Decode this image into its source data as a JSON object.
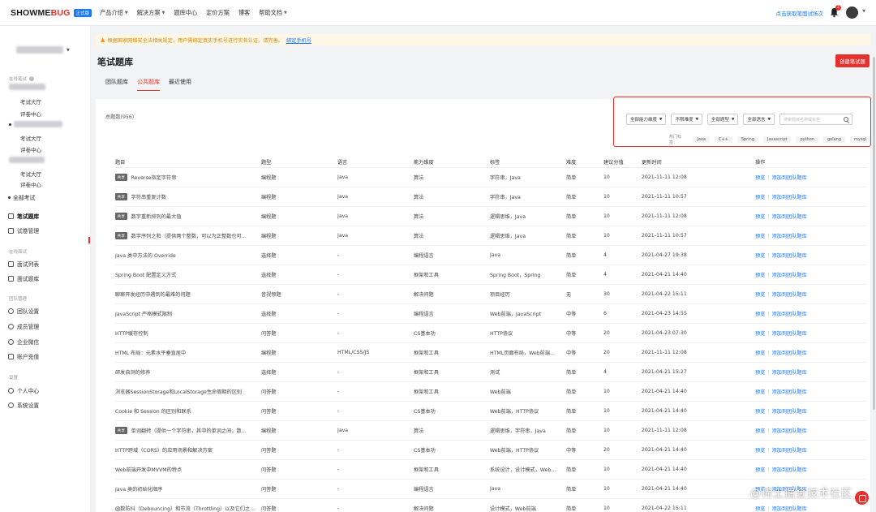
{
  "header": {
    "logo_main": "SHOWME",
    "logo_accent": "BUG",
    "version_badge": "正式版",
    "nav": [
      {
        "label": "产品介绍",
        "has_caret": true
      },
      {
        "label": "解决方案",
        "has_caret": true
      },
      {
        "label": "题库中心",
        "has_caret": false
      },
      {
        "label": "定价方案",
        "has_caret": false
      },
      {
        "label": "博客",
        "has_caret": false
      },
      {
        "label": "帮助文档",
        "has_caret": true
      }
    ],
    "trial_link": "点击获取笔面试场次",
    "bell_count": "2"
  },
  "sidebar": {
    "section_written": "在线笔试",
    "exam_hall_1": "考试大厅",
    "review_1": "评卷中心",
    "exam_hall_2": "考试大厅",
    "review_2": "评卷中心",
    "exam_hall_3": "考试大厅",
    "review_3": "评卷中心",
    "all_exams": "全部考试",
    "question_bank": "笔试题库",
    "paper_manage": "试卷管理",
    "section_interview": "在线面试",
    "interview_list": "面试列表",
    "interview_bank": "面试题库",
    "section_team": "团队管理",
    "team_settings": "团队设置",
    "member_manage": "成员管理",
    "wecom": "企业微信",
    "recharge": "账户充值",
    "section_settings": "设置",
    "personal_center": "个人中心",
    "system_settings": "系统设置"
  },
  "notice": {
    "text": "根据国家网络安全法相关规定，用户需绑定真实手机号进行实名认证，请完善。",
    "link": "绑定手机号"
  },
  "page": {
    "title": "笔试题库",
    "create_button": "创建笔试题",
    "tabs": [
      "团队题库",
      "公共题库",
      "最近使用"
    ],
    "active_tab": 1,
    "total": "总题数(956)"
  },
  "filters": {
    "ability": "全部能力维度",
    "difficulty": "不限难度",
    "type": "全部题型",
    "language": "全部语言",
    "search_placeholder": "搜索题目名称或标签",
    "hot_label": "热门标签：",
    "hot_tags": [
      "Java",
      "C++",
      "Spring",
      "Javascript",
      "python",
      "golang",
      "mysql"
    ]
  },
  "table": {
    "headers": [
      "题目",
      "题型",
      "语言",
      "能力维度",
      "标签",
      "难度",
      "建议分值",
      "更新时间",
      "操作"
    ],
    "action_preview": "预览",
    "action_add": "添加到团队题库",
    "rows": [
      {
        "tag": "共享",
        "title": "Reverse指定字符串",
        "type": "编程题",
        "lang": "Java",
        "ability": "算法",
        "labels": "字符串，Java",
        "difficulty": "简单",
        "score": "10",
        "updated": "2021-11-11 12:08"
      },
      {
        "tag": "共享",
        "title": "字符串重复计数",
        "type": "编程题",
        "lang": "Java",
        "ability": "算法",
        "labels": "字符串，Java",
        "difficulty": "简单",
        "score": "10",
        "updated": "2021-11-11 10:57"
      },
      {
        "tag": "共享",
        "title": "数字重新排列的最大值",
        "type": "编程题",
        "lang": "Java",
        "ability": "算法",
        "labels": "逻辑思维，Java",
        "difficulty": "简单",
        "score": "10",
        "updated": "2021-11-11 12:08"
      },
      {
        "tag": "共享",
        "title": "数字序列之和（提供两个整数，可以为正整数也可...",
        "type": "编程题",
        "lang": "Java",
        "ability": "算法",
        "labels": "逻辑思维，Java",
        "difficulty": "简单",
        "score": "10",
        "updated": "2021-11-11 10:57"
      },
      {
        "tag": "",
        "title": "Java 类中方法的 Override",
        "type": "选择题",
        "lang": "-",
        "ability": "编程语言",
        "labels": "Java",
        "difficulty": "简单",
        "score": "4",
        "updated": "2021-04-27 19:38"
      },
      {
        "tag": "",
        "title": "Spring Boot 配置定义方式",
        "type": "选择题",
        "lang": "-",
        "ability": "框架和工具",
        "labels": "Spring Boot，Spring",
        "difficulty": "简单",
        "score": "4",
        "updated": "2021-04-21 14:40"
      },
      {
        "tag": "",
        "title": "聊聊开发经历中遇到的最难的问题",
        "type": "音视频题",
        "lang": "-",
        "ability": "解决问题",
        "labels": "项目经历",
        "difficulty": "无",
        "score": "30",
        "updated": "2021-04-22 15:11"
      },
      {
        "tag": "",
        "title": "JavaScript 严格模式限制",
        "type": "选择题",
        "lang": "-",
        "ability": "编程语言",
        "labels": "Web前端，JavaScript",
        "difficulty": "中等",
        "score": "6",
        "updated": "2021-04-23 14:55"
      },
      {
        "tag": "",
        "title": "HTTP缓存控制",
        "type": "问答题",
        "lang": "-",
        "ability": "CS基本功",
        "labels": "HTTP协议",
        "difficulty": "中等",
        "score": "20",
        "updated": "2021-04-23 07:30"
      },
      {
        "tag": "",
        "title": "HTML 布局：元素水平垂直居中",
        "type": "编程题",
        "lang": "HTML/CSS/JS",
        "ability": "框架和工具",
        "labels": "HTML页面布局，Web前端...",
        "difficulty": "中等",
        "score": "20",
        "updated": "2021-11-11 12:08"
      },
      {
        "tag": "",
        "title": "研发自测的修养",
        "type": "选择题",
        "lang": "-",
        "ability": "框架和工具",
        "labels": "测试",
        "difficulty": "简单",
        "score": "4",
        "updated": "2021-04-21 15:27"
      },
      {
        "tag": "",
        "title": "浏览器SessionStorage和LocalStorage生命周期的区别",
        "type": "问答题",
        "lang": "-",
        "ability": "框架和工具",
        "labels": "Web前端",
        "difficulty": "简单",
        "score": "10",
        "updated": "2021-04-21 14:40"
      },
      {
        "tag": "",
        "title": "Cookie 和 Session 的区别和联系",
        "type": "问答题",
        "lang": "-",
        "ability": "CS基本功",
        "labels": "Web前端，HTTP协议",
        "difficulty": "简单",
        "score": "10",
        "updated": "2021-04-21 14:40"
      },
      {
        "tag": "共享",
        "title": "单词翻转（提供一个字符串，其中的单词之间，数...",
        "type": "编程题",
        "lang": "Java",
        "ability": "算法",
        "labels": "逻辑思维，字符串，Java",
        "difficulty": "简单",
        "score": "10",
        "updated": "2021-11-11 12:08"
      },
      {
        "tag": "",
        "title": "HTTP跨域（CORS）的应用场景和解决方案",
        "type": "问答题",
        "lang": "-",
        "ability": "CS基本功",
        "labels": "Web前端，HTTP协议",
        "difficulty": "中等",
        "score": "20",
        "updated": "2021-04-21 14:40"
      },
      {
        "tag": "",
        "title": "Web前端开发中MVVM的特点",
        "type": "问答题",
        "lang": "-",
        "ability": "框架和工具",
        "labels": "系统设计，设计模式，Web...",
        "difficulty": "简单",
        "score": "10",
        "updated": "2021-04-21 14:40"
      },
      {
        "tag": "",
        "title": "Java 类的初始化顺序",
        "type": "问答题",
        "lang": "-",
        "ability": "编程语言",
        "labels": "Java",
        "difficulty": "简单",
        "score": "10",
        "updated": "2021-04-21 14:40"
      },
      {
        "tag": "",
        "title": "函数防抖（Debouncing）和节流（Throttling）以及它们之...",
        "type": "问答题",
        "lang": "-",
        "ability": "解决问题",
        "labels": "设计模式，Web前端",
        "difficulty": "简单",
        "score": "10",
        "updated": "2021-04-22 15:11"
      }
    ]
  },
  "watermark": "@稀土掘金技术社区",
  "colors": {
    "brand_red": "#e5302b",
    "link_blue": "#1677ff",
    "notice_bg": "#fff7e6"
  }
}
